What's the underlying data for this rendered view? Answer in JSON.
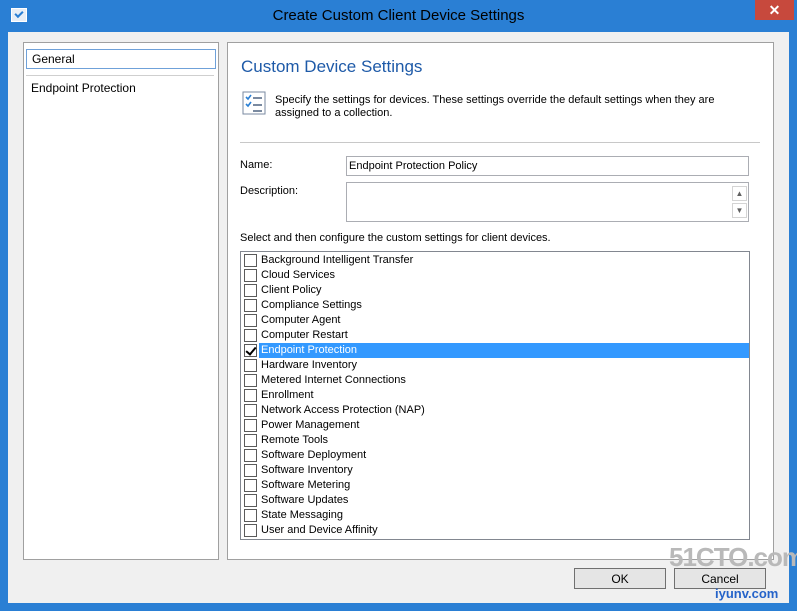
{
  "window": {
    "title": "Create Custom Client Device Settings",
    "close_glyph": "✕"
  },
  "sidebar": {
    "items": [
      {
        "label": "General",
        "selected": true
      },
      {
        "label": "Endpoint Protection",
        "selected": false
      }
    ]
  },
  "main": {
    "heading": "Custom Device Settings",
    "intro": "Specify the settings for devices. These settings override the default settings when they are assigned to a collection.",
    "name_label": "Name:",
    "name_value": "Endpoint Protection Policy",
    "description_label": "Description:",
    "description_value": "",
    "list_label": "Select and then configure the custom settings for client devices.",
    "settings": [
      {
        "label": "Background Intelligent Transfer",
        "checked": false
      },
      {
        "label": "Cloud Services",
        "checked": false
      },
      {
        "label": "Client Policy",
        "checked": false
      },
      {
        "label": "Compliance Settings",
        "checked": false
      },
      {
        "label": "Computer Agent",
        "checked": false
      },
      {
        "label": "Computer Restart",
        "checked": false
      },
      {
        "label": "Endpoint Protection",
        "checked": true,
        "selected": true
      },
      {
        "label": "Hardware Inventory",
        "checked": false
      },
      {
        "label": "Metered Internet Connections",
        "checked": false
      },
      {
        "label": "Enrollment",
        "checked": false
      },
      {
        "label": "Network Access Protection (NAP)",
        "checked": false
      },
      {
        "label": "Power Management",
        "checked": false
      },
      {
        "label": "Remote Tools",
        "checked": false
      },
      {
        "label": "Software Deployment",
        "checked": false
      },
      {
        "label": "Software Inventory",
        "checked": false
      },
      {
        "label": "Software Metering",
        "checked": false
      },
      {
        "label": "Software Updates",
        "checked": false
      },
      {
        "label": "State Messaging",
        "checked": false
      },
      {
        "label": "User and Device Affinity",
        "checked": false
      }
    ]
  },
  "buttons": {
    "ok": "OK",
    "cancel": "Cancel"
  },
  "watermark": {
    "line1": "51CTO.com",
    "line2": "iyunv.com"
  },
  "colors": {
    "title_bar": "#2a7fd4",
    "close_button": "#c7493d",
    "heading": "#1e5aa8",
    "selection": "#3399ff"
  }
}
